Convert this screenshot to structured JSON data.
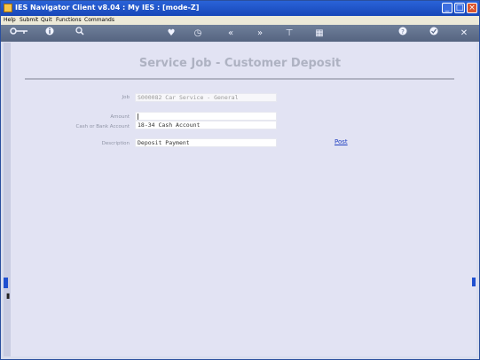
{
  "window": {
    "title": "IES Navigator Client v8.04 : My IES :      [mode-Z]"
  },
  "menu": [
    {
      "label": "Help"
    },
    {
      "label": "Submit"
    },
    {
      "label": "Quit"
    },
    {
      "label": "Functions"
    },
    {
      "label": "Commands"
    }
  ],
  "toolbar": {
    "icons": [
      "key-icon",
      "info-icon",
      "search-icon",
      "heart-icon",
      "clock-icon",
      "back-icon",
      "forward-icon",
      "bookmark-icon",
      "grid-icon",
      "help-icon",
      "check-icon",
      "close-icon"
    ]
  },
  "form": {
    "heading": "Service Job - Customer Deposit",
    "job_label": "Job",
    "job_value": "S000082 Car Service - General",
    "amount_label": "Amount",
    "amount_value": "",
    "account_label": "Cash or Bank Account",
    "account_value": "18-34 Cash Account",
    "description_label": "Description",
    "description_value": "Deposit Payment",
    "post_label": "Post"
  }
}
